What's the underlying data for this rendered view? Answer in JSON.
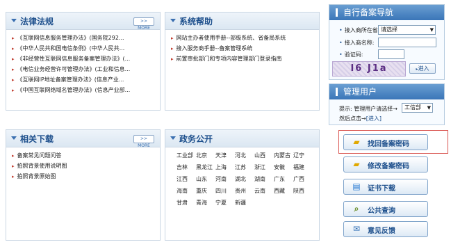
{
  "laws": {
    "title": "法律法规",
    "more": ">> MORE",
    "items": [
      "《互联网信息服务管理办法》(国务院292...",
      "《中华人民共和国电信条例》(中华人民共...",
      "《非经营性互联网信息服务备案管理办法》(...",
      "《电信业务经营许可管理办法》(工业和信息...",
      "《互联网IP地址备案管理办法》(信息产业...",
      "《中国互联网络域名管理办法》(信息产业部..."
    ]
  },
  "help": {
    "title": "系统帮助",
    "items": [
      "网站主办者使用手册--部级系统、省备局系统",
      "接入服务商手册--备案管理系统",
      "前置审批部门和专项内容管理部门登录指南"
    ]
  },
  "downloads": {
    "title": "相关下载",
    "more": ">> MORE",
    "items": [
      "备案常见问题问答",
      "拍照背景使用说明图",
      "拍照背景原始图"
    ]
  },
  "gov": {
    "title": "政务公开",
    "rows": [
      [
        "工业部",
        "北京",
        "天津",
        "河北",
        "山西",
        "内蒙古",
        "辽宁"
      ],
      [
        "吉林",
        "黑龙江",
        "上海",
        "江苏",
        "浙江",
        "安徽",
        "福建"
      ],
      [
        "江西",
        "山东",
        "河南",
        "湖北",
        "湖南",
        "广东",
        "广西"
      ],
      [
        "海南",
        "重庆",
        "四川",
        "贵州",
        "云南",
        "西藏",
        "陕西"
      ],
      [
        "甘肃",
        "青海",
        "宁夏",
        "新疆"
      ]
    ]
  },
  "nav": {
    "title": "自行备案导航",
    "isp_label": "接入商所在省:",
    "isp_value": "请选择",
    "isp_arrow": "▼",
    "isp_name_label": "接入商名称:",
    "captcha_label": "验证码:",
    "captcha_text": "I6 J1a",
    "enter_button": "进入"
  },
  "admin": {
    "title": "管理用户",
    "hint_prefix": "提示: 管理用户请选择→",
    "select_value": "工信部",
    "select_arrow": "▼",
    "hint_suffix": "然后点击→",
    "enter_link": "[进入]"
  },
  "actions": [
    {
      "label": "找回备案密码",
      "icon": "folder-key-icon"
    },
    {
      "label": "修改备案密码",
      "icon": "folder-edit-icon"
    },
    {
      "label": "证书下载",
      "icon": "certificate-download-icon"
    },
    {
      "label": "公共查询",
      "icon": "search-query-icon"
    },
    {
      "label": "意见反馈",
      "icon": "feedback-icon"
    }
  ]
}
